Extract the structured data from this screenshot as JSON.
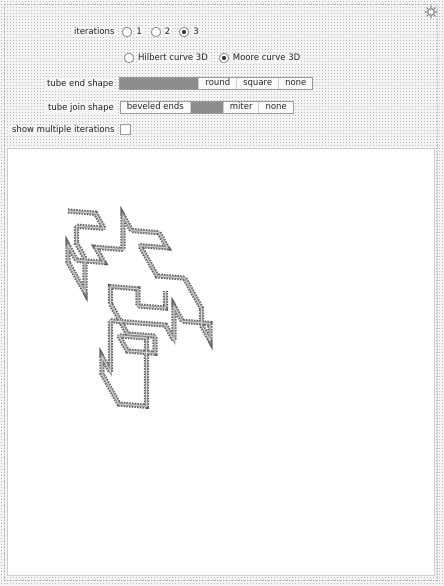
{
  "controls": {
    "iterations": {
      "label": "iterations",
      "options": [
        "1",
        "2",
        "3"
      ],
      "selected": "3"
    },
    "curve_type": {
      "options": [
        "Hilbert curve 3D",
        "Moore curve 3D"
      ],
      "selected": "Moore curve 3D"
    },
    "tube_end_shape": {
      "label": "tube end shape",
      "options": [
        "",
        "round",
        "square",
        "none"
      ],
      "selected_index": 0
    },
    "tube_join_shape": {
      "label": "tube join shape",
      "options": [
        "beveled ends",
        "",
        "miter",
        "none"
      ],
      "selected_index": 1
    },
    "show_multiple": {
      "label": "show multiple iterations",
      "checked": false
    }
  },
  "icons": {
    "settings": "gear-icon"
  },
  "colors": {
    "tube": "#8f8f8f",
    "tube_edge": "#5a5a5a",
    "background": "#ffffff"
  }
}
